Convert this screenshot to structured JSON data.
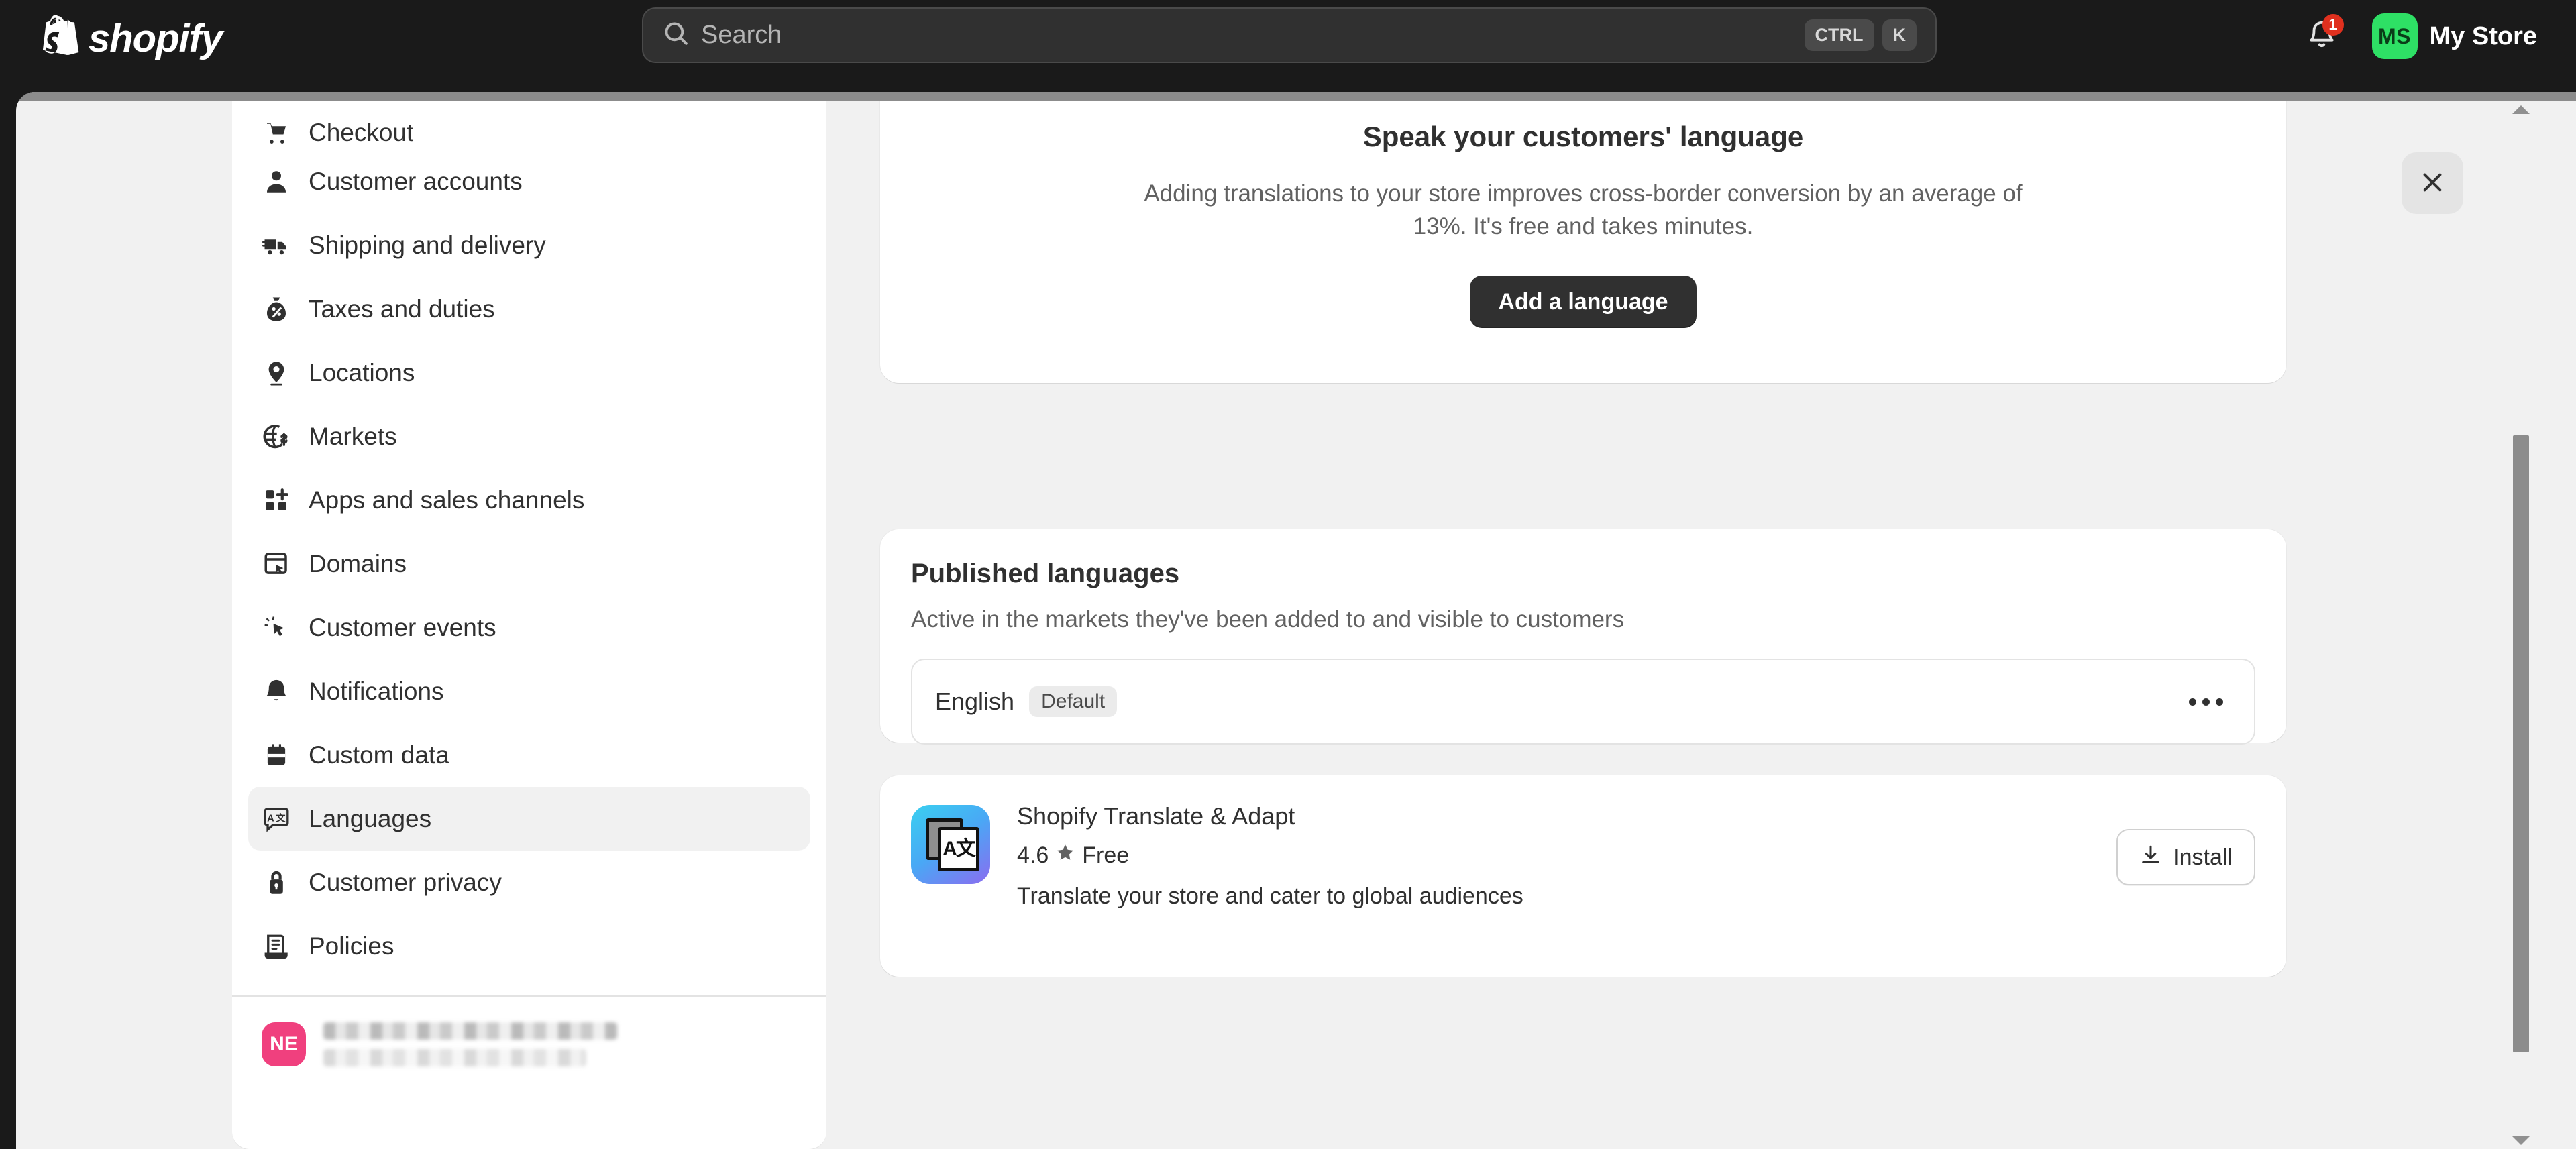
{
  "topbar": {
    "brand": "shopify",
    "brand_icon": "shopify-bag-logo",
    "search": {
      "icon": "search-icon",
      "placeholder": "Search",
      "value": "",
      "shortcut_modifier": "CTRL",
      "shortcut_key": "K"
    },
    "notifications": {
      "icon": "bell-icon",
      "count": "1"
    },
    "store": {
      "initials": "MS",
      "name": "My Store",
      "avatar_color": "#2ee065"
    },
    "background_color": "#1a1a1a"
  },
  "sidebar": {
    "items": [
      {
        "label": "Checkout",
        "icon": "checkout-cart-icon",
        "active": false
      },
      {
        "label": "Customer accounts",
        "icon": "person-icon",
        "active": false
      },
      {
        "label": "Shipping and delivery",
        "icon": "delivery-truck-icon",
        "active": false
      },
      {
        "label": "Taxes and duties",
        "icon": "money-bag-percent-icon",
        "active": false
      },
      {
        "label": "Locations",
        "icon": "location-pin-icon",
        "active": false
      },
      {
        "label": "Markets",
        "icon": "globe-dollar-icon",
        "active": false
      },
      {
        "label": "Apps and sales channels",
        "icon": "apps-grid-plus-icon",
        "active": false
      },
      {
        "label": "Domains",
        "icon": "domains-window-icon",
        "active": false
      },
      {
        "label": "Customer events",
        "icon": "click-cursor-icon",
        "active": false
      },
      {
        "label": "Notifications",
        "icon": "bell-icon",
        "active": false
      },
      {
        "label": "Custom data",
        "icon": "database-icon",
        "active": false
      },
      {
        "label": "Languages",
        "icon": "translate-icon",
        "active": true
      },
      {
        "label": "Customer privacy",
        "icon": "lock-icon",
        "active": false
      },
      {
        "label": "Policies",
        "icon": "policies-document-icon",
        "active": false
      }
    ],
    "user": {
      "initials": "NE",
      "avatar_color": "#f0407e",
      "name_redacted": true,
      "detail_redacted": true
    }
  },
  "main": {
    "hero": {
      "art": "speech-bubbles-illustration",
      "title": "Speak your customers' language",
      "subtitle": "Adding translations to your store improves cross-border conversion by an average of 13%. It's free and takes minutes.",
      "cta_label": "Add a language"
    },
    "published": {
      "title": "Published languages",
      "subtitle": "Active in the markets they've been added to and visible to customers",
      "rows": [
        {
          "language": "English",
          "badge": "Default",
          "menu_icon": "more-horizontal-icon"
        }
      ]
    },
    "app": {
      "icon": "translate-adapt-app-icon",
      "name": "Shopify Translate & Adapt",
      "rating": "4.6",
      "rating_icon": "star-icon",
      "price": "Free",
      "description": "Translate your store and cater to global audiences",
      "install_label": "Install",
      "install_icon": "download-icon"
    },
    "close_icon": "close-icon"
  },
  "scrollbar": {
    "up_icon": "chevron-up-icon",
    "down_icon": "chevron-down-icon"
  }
}
